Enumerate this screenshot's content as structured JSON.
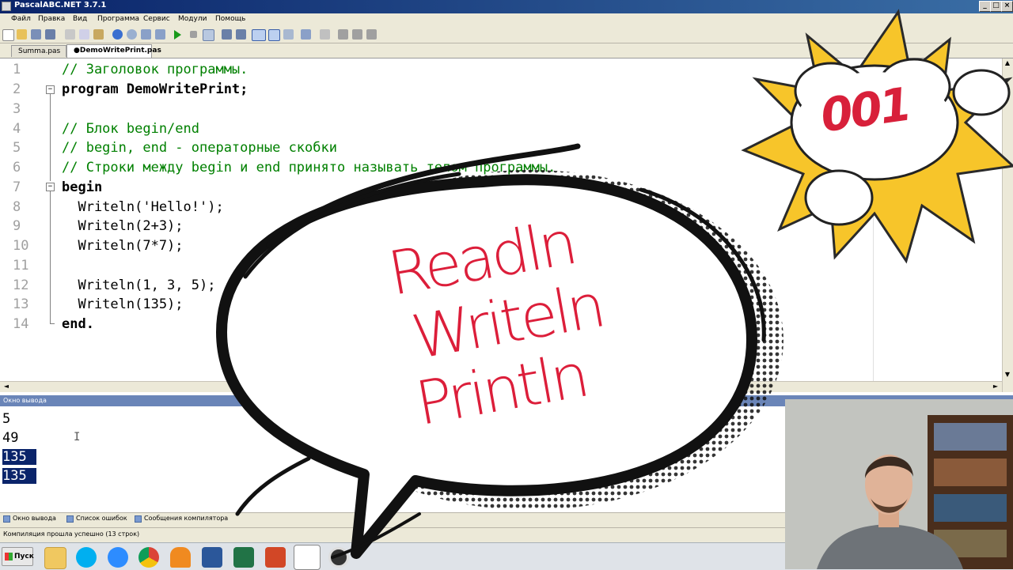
{
  "window": {
    "title": "PascalABC.NET 3.7.1",
    "controls": [
      "_",
      "□",
      "×"
    ]
  },
  "menu": [
    "Файл",
    "Правка",
    "Вид",
    "Программа",
    "Сервис",
    "Модули",
    "Помощь"
  ],
  "tabs": [
    {
      "label": "Summa.pas",
      "active": false
    },
    {
      "label": "●DemoWritePrint.pas",
      "active": true
    }
  ],
  "editor": {
    "line_numbers": [
      "1",
      "2",
      "3",
      "4",
      "5",
      "6",
      "7",
      "8",
      "9",
      "10",
      "11",
      "12",
      "13",
      "14"
    ],
    "lines": [
      "// Заголовок программы.",
      "program DemoWritePrint;",
      "",
      "// Блок begin/end",
      "// begin, end - операторные скобки",
      "// Строки между begin и end принято называть телом программы.",
      "begin",
      "  Writeln('Hello!');",
      "  Writeln(2+3);",
      "  Writeln(7*7);",
      "",
      "  Writeln(1, 3, 5);",
      "  Writeln(135);",
      "end."
    ]
  },
  "output": {
    "header": "Окно вывода",
    "lines": [
      "5",
      "49",
      "135",
      "135"
    ],
    "selected": [
      2,
      3
    ]
  },
  "bottom_tabs": [
    "Окно вывода",
    "Список ошибок",
    "Сообщения компилятора"
  ],
  "status": "Компиляция прошла успешно (13 строк)",
  "taskbar": {
    "start_label": "Пуск",
    "apps": [
      "explorer-icon",
      "skype-icon",
      "zoom-icon",
      "chrome-icon",
      "butterfly-icon",
      "word-icon",
      "excel-icon",
      "powerpoint-icon",
      "pascalabc-icon",
      "obs-icon"
    ]
  },
  "overlay": {
    "episode": "001",
    "bubble_words": [
      "Readln",
      "Writeln",
      "Println"
    ]
  },
  "colors": {
    "accent_red": "#dc1e3a",
    "title_bar": "#0a246a",
    "comment_green": "#008000",
    "string_blue": "#0000ff",
    "selection": "#0a246a"
  }
}
